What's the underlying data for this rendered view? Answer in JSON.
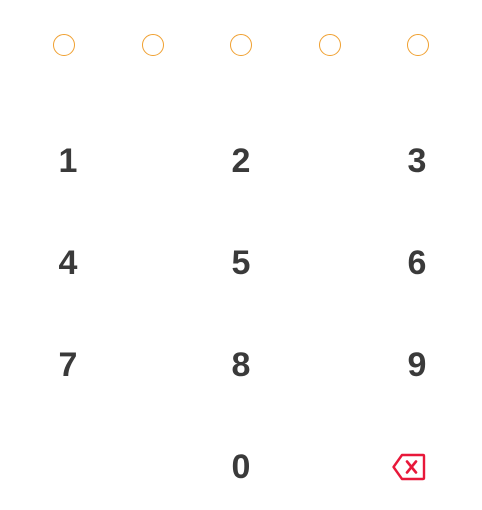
{
  "pin": {
    "length": 5,
    "filled": 0,
    "dot_color": "#f0a030"
  },
  "keypad": {
    "keys": [
      "1",
      "2",
      "3",
      "4",
      "5",
      "6",
      "7",
      "8",
      "9",
      "0"
    ],
    "backspace_icon": "backspace-icon",
    "backspace_color": "#e8183a",
    "digit_color": "#3a3a3a"
  }
}
